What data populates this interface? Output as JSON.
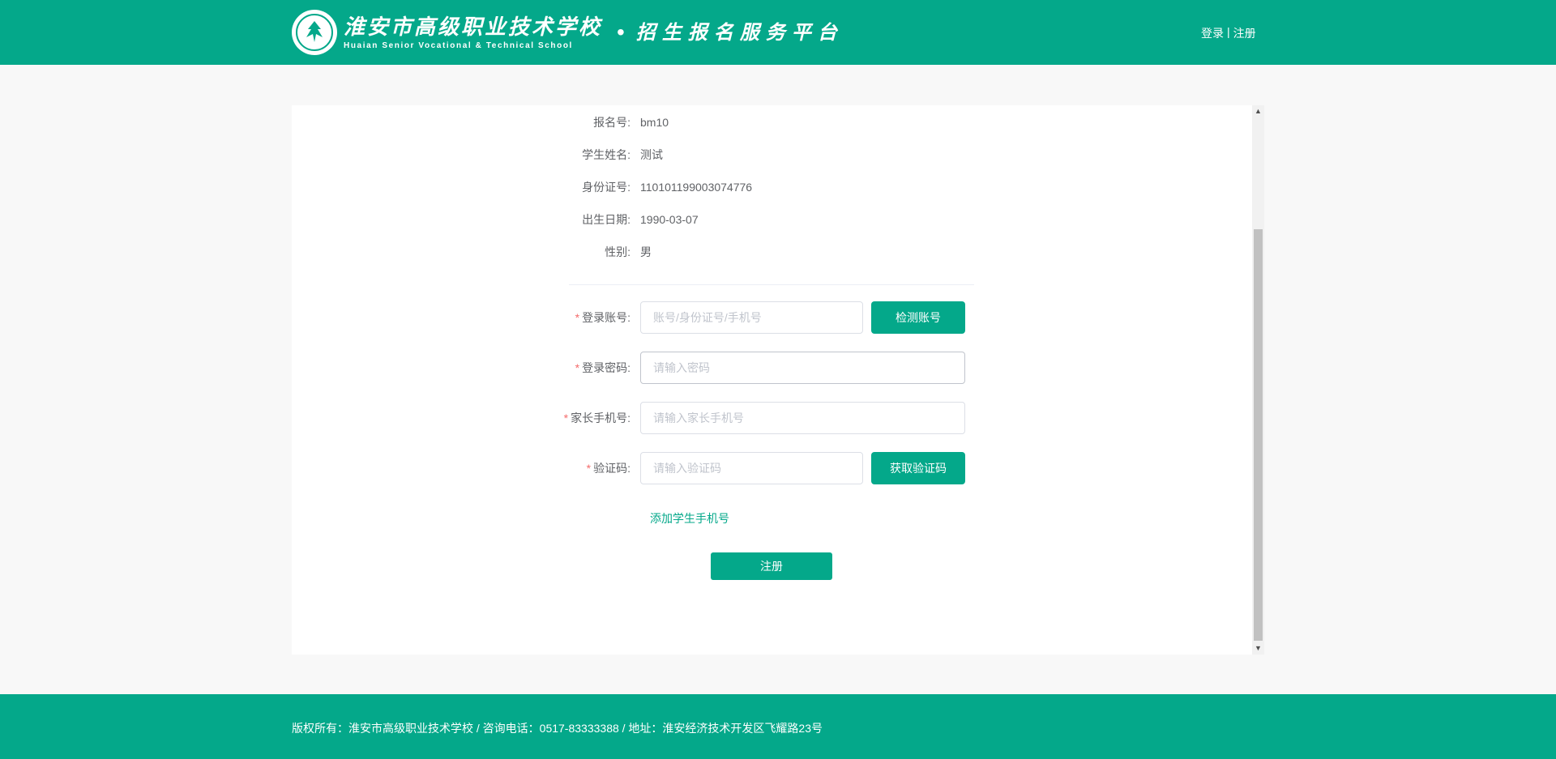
{
  "header": {
    "school_name_cn": "淮安市高级职业技术学校",
    "school_name_en": "Huaian Senior Vocational & Technical School",
    "separator": "•",
    "platform_name": "招生报名服务平台",
    "login_label": "登录",
    "link_separator": "|",
    "register_label": "注册"
  },
  "info": [
    {
      "label": "报名号:",
      "value": "bm10"
    },
    {
      "label": "学生姓名:",
      "value": "测试"
    },
    {
      "label": "身份证号:",
      "value": "110101199003074776"
    },
    {
      "label": "出生日期:",
      "value": "1990-03-07"
    },
    {
      "label": "性别:",
      "value": "男"
    }
  ],
  "form": {
    "required_mark": "*",
    "account": {
      "label": "登录账号:",
      "placeholder": "账号/身份证号/手机号",
      "value": "",
      "button": "检测账号"
    },
    "password": {
      "label": "登录密码:",
      "placeholder": "请输入密码",
      "value": ""
    },
    "parent_phone": {
      "label": "家长手机号:",
      "placeholder": "请输入家长手机号",
      "value": ""
    },
    "code": {
      "label": "验证码:",
      "placeholder": "请输入验证码",
      "value": "",
      "button": "获取验证码"
    },
    "add_student_phone": "添加学生手机号",
    "submit": "注册"
  },
  "footer": {
    "text": "版权所有：淮安市高级职业技术学校 / 咨询电话：0517-83333388 / 地址：淮安经济技术开发区飞耀路23号"
  },
  "colors": {
    "brand": "#04a88a",
    "required": "#f56c6c"
  }
}
